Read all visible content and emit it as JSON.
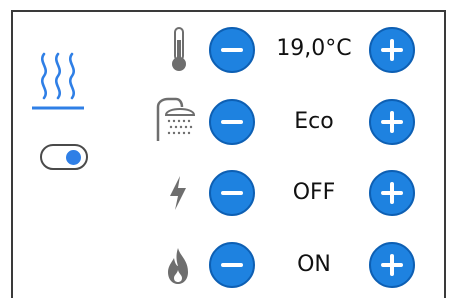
{
  "controls": {
    "temperature": {
      "icon": "thermometer-icon",
      "value": "19,0°C"
    },
    "shower": {
      "icon": "shower-icon",
      "value": "Eco"
    },
    "power": {
      "icon": "lightning-icon",
      "value": "OFF"
    },
    "flame": {
      "icon": "flame-icon",
      "value": "ON"
    }
  },
  "heating_toggle": {
    "state": "on"
  },
  "colors": {
    "accent": "#1e82e0",
    "accent_border": "#0d5fb3",
    "icon_gray": "#6e6e6e",
    "border": "#3a3a3a"
  }
}
